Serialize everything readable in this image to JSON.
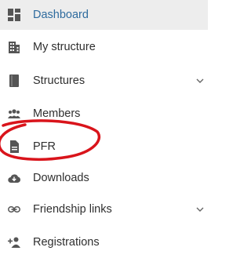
{
  "menu": {
    "items": [
      {
        "label": "Dashboard",
        "icon": "dashboard-icon",
        "active": true
      },
      {
        "label": "My structure",
        "icon": "building-icon"
      },
      {
        "label": "Structures",
        "icon": "book-icon",
        "expandable": true
      },
      {
        "label": "Members",
        "icon": "people-icon"
      },
      {
        "label": "PFR",
        "icon": "document-icon"
      },
      {
        "label": "Downloads",
        "icon": "cloud-download-icon"
      },
      {
        "label": "Friendship links",
        "icon": "link-icon",
        "expandable": true
      },
      {
        "label": "Registrations",
        "icon": "add-person-icon"
      }
    ]
  },
  "colors": {
    "active_background": "#ededed",
    "active_text": "#2e6b9e",
    "text": "#2f2f2f",
    "icon": "#555555",
    "annotation": "#d9141b"
  }
}
